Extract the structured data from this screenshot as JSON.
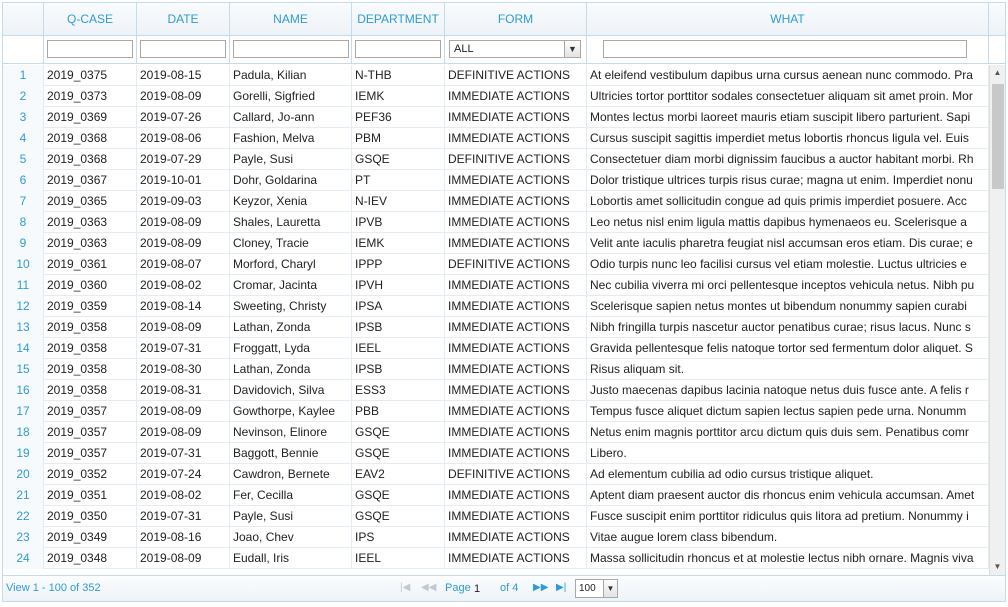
{
  "columns": [
    {
      "label": ""
    },
    {
      "label": "Q-CASE"
    },
    {
      "label": "DATE"
    },
    {
      "label": "NAME"
    },
    {
      "label": "DEPARTMENT"
    },
    {
      "label": "FORM"
    },
    {
      "label": "WHAT"
    }
  ],
  "filters": {
    "form_selected": "ALL"
  },
  "rows": [
    {
      "n": "1",
      "qcase": "2019_0375",
      "date": "2019-08-15",
      "name": "Padula, Kilian",
      "dept": "N-THB",
      "form": "DEFINITIVE ACTIONS",
      "what": "At eleifend vestibulum dapibus urna cursus aenean nunc commodo. Pra"
    },
    {
      "n": "2",
      "qcase": "2019_0373",
      "date": "2019-08-09",
      "name": "Gorelli, Sigfried",
      "dept": "IEMK",
      "form": "IMMEDIATE ACTIONS",
      "what": "Ultricies tortor porttitor sodales consectetuer aliquam sit amet proin. Mor"
    },
    {
      "n": "3",
      "qcase": "2019_0369",
      "date": "2019-07-26",
      "name": "Callard, Jo-ann",
      "dept": "PEF36",
      "form": "IMMEDIATE ACTIONS",
      "what": "Montes lectus morbi laoreet mauris etiam suscipit libero parturient. Sapi"
    },
    {
      "n": "4",
      "qcase": "2019_0368",
      "date": "2019-08-06",
      "name": "Fashion, Melva",
      "dept": "PBM",
      "form": "IMMEDIATE ACTIONS",
      "what": "Cursus suscipit sagittis imperdiet metus lobortis rhoncus ligula vel. Euis"
    },
    {
      "n": "5",
      "qcase": "2019_0368",
      "date": "2019-07-29",
      "name": "Payle, Susi",
      "dept": "GSQE",
      "form": "DEFINITIVE ACTIONS",
      "what": "Consectetuer diam morbi dignissim faucibus a auctor habitant morbi. Rh"
    },
    {
      "n": "6",
      "qcase": "2019_0367",
      "date": "2019-10-01",
      "name": "Dohr, Goldarina",
      "dept": "PT",
      "form": "IMMEDIATE ACTIONS",
      "what": "Dolor tristique ultrices turpis risus curae; magna ut enim. Imperdiet nonu"
    },
    {
      "n": "7",
      "qcase": "2019_0365",
      "date": "2019-09-03",
      "name": "Keyzor, Xenia",
      "dept": "N-IEV",
      "form": "IMMEDIATE ACTIONS",
      "what": "Lobortis amet sollicitudin congue ad quis primis imperdiet posuere. Acc"
    },
    {
      "n": "8",
      "qcase": "2019_0363",
      "date": "2019-08-09",
      "name": "Shales, Lauretta",
      "dept": "IPVB",
      "form": "IMMEDIATE ACTIONS",
      "what": "Leo netus nisl enim ligula mattis dapibus hymenaeos eu. Scelerisque a"
    },
    {
      "n": "9",
      "qcase": "2019_0363",
      "date": "2019-08-09",
      "name": "Cloney, Tracie",
      "dept": "IEMK",
      "form": "IMMEDIATE ACTIONS",
      "what": "Velit ante iaculis pharetra feugiat nisl accumsan eros etiam. Dis curae; e"
    },
    {
      "n": "10",
      "qcase": "2019_0361",
      "date": "2019-08-07",
      "name": "Morford, Charyl",
      "dept": "IPPP",
      "form": "DEFINITIVE ACTIONS",
      "what": "Odio turpis nunc leo facilisi cursus vel etiam molestie. Luctus ultricies e"
    },
    {
      "n": "11",
      "qcase": "2019_0360",
      "date": "2019-08-02",
      "name": "Cromar, Jacinta",
      "dept": "IPVH",
      "form": "IMMEDIATE ACTIONS",
      "what": "Nec cubilia viverra mi orci pellentesque inceptos vehicula netus. Nibh pu"
    },
    {
      "n": "12",
      "qcase": "2019_0359",
      "date": "2019-08-14",
      "name": "Sweeting, Christy",
      "dept": "IPSA",
      "form": "IMMEDIATE ACTIONS",
      "what": "Scelerisque sapien netus montes ut bibendum nonummy sapien curabi"
    },
    {
      "n": "13",
      "qcase": "2019_0358",
      "date": "2019-08-09",
      "name": "Lathan, Zonda",
      "dept": "IPSB",
      "form": "IMMEDIATE ACTIONS",
      "what": "Nibh fringilla turpis nascetur auctor penatibus curae; risus lacus. Nunc s"
    },
    {
      "n": "14",
      "qcase": "2019_0358",
      "date": "2019-07-31",
      "name": "Froggatt, Lyda",
      "dept": "IEEL",
      "form": "IMMEDIATE ACTIONS",
      "what": "Gravida pellentesque felis natoque tortor sed fermentum dolor aliquet. S"
    },
    {
      "n": "15",
      "qcase": "2019_0358",
      "date": "2019-08-30",
      "name": "Lathan, Zonda",
      "dept": "IPSB",
      "form": "IMMEDIATE ACTIONS",
      "what": "Risus aliquam sit."
    },
    {
      "n": "16",
      "qcase": "2019_0358",
      "date": "2019-08-31",
      "name": "Davidovich, Silva",
      "dept": "ESS3",
      "form": "IMMEDIATE ACTIONS",
      "what": "Justo maecenas dapibus lacinia natoque netus duis fusce ante. A felis r"
    },
    {
      "n": "17",
      "qcase": "2019_0357",
      "date": "2019-08-09",
      "name": "Gowthorpe, Kaylee",
      "dept": "PBB",
      "form": "IMMEDIATE ACTIONS",
      "what": "Tempus fusce aliquet dictum sapien lectus sapien pede urna. Nonumm"
    },
    {
      "n": "18",
      "qcase": "2019_0357",
      "date": "2019-08-09",
      "name": "Nevinson, Elinore",
      "dept": "GSQE",
      "form": "IMMEDIATE ACTIONS",
      "what": "Netus enim magnis porttitor arcu dictum quis duis sem. Penatibus comr"
    },
    {
      "n": "19",
      "qcase": "2019_0357",
      "date": "2019-07-31",
      "name": "Baggott, Bennie",
      "dept": "GSQE",
      "form": "IMMEDIATE ACTIONS",
      "what": "Libero."
    },
    {
      "n": "20",
      "qcase": "2019_0352",
      "date": "2019-07-24",
      "name": "Cawdron, Bernete",
      "dept": "EAV2",
      "form": "DEFINITIVE ACTIONS",
      "what": "Ad elementum cubilia ad odio cursus tristique aliquet."
    },
    {
      "n": "21",
      "qcase": "2019_0351",
      "date": "2019-08-02",
      "name": "Fer, Cecilla",
      "dept": "GSQE",
      "form": "IMMEDIATE ACTIONS",
      "what": "Aptent diam praesent auctor dis rhoncus enim vehicula accumsan. Amet"
    },
    {
      "n": "22",
      "qcase": "2019_0350",
      "date": "2019-07-31",
      "name": "Payle, Susi",
      "dept": "GSQE",
      "form": "IMMEDIATE ACTIONS",
      "what": "Fusce suscipit enim porttitor ridiculus quis litora ad pretium. Nonummy i"
    },
    {
      "n": "23",
      "qcase": "2019_0349",
      "date": "2019-08-16",
      "name": "Joao, Chev",
      "dept": "IPS",
      "form": "IMMEDIATE ACTIONS",
      "what": "Vitae augue lorem class bibendum."
    },
    {
      "n": "24",
      "qcase": "2019_0348",
      "date": "2019-08-09",
      "name": "Eudall, Iris",
      "dept": "IEEL",
      "form": "IMMEDIATE ACTIONS",
      "what": "Massa sollicitudin rhoncus et at molestie lectus nibh ornare. Magnis viva"
    }
  ],
  "pager": {
    "info": "View 1 - 100 of 352",
    "page_label": "Page",
    "page_value": "1",
    "of_label": "of 4",
    "next_icon": "next-icon",
    "last_icon": "last-icon",
    "page_size": "100"
  },
  "colors": {
    "accent": "#2e9bd6",
    "border": "#c5dbec"
  }
}
